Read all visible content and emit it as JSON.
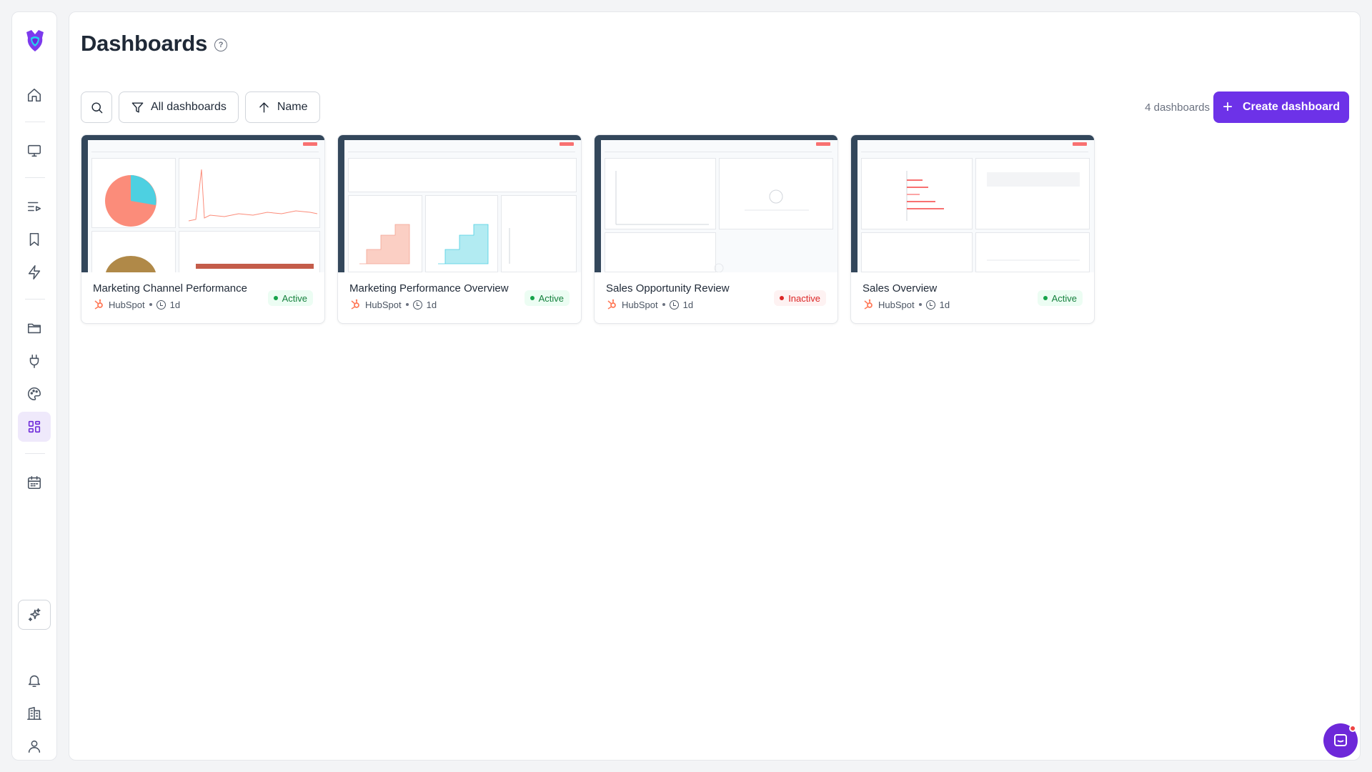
{
  "page": {
    "title": "Dashboards",
    "count_label": "4 dashboards",
    "create_label": "Create dashboard"
  },
  "toolbar": {
    "filter_label": "All dashboards",
    "sort_label": "Name"
  },
  "sidebar": {
    "items": [
      {
        "name": "home-icon"
      },
      {
        "name": "monitor-icon"
      },
      {
        "name": "playlist-icon"
      },
      {
        "name": "bookmark-icon"
      },
      {
        "name": "lightning-icon"
      },
      {
        "name": "folder-icon"
      },
      {
        "name": "plug-icon"
      },
      {
        "name": "palette-icon"
      },
      {
        "name": "dashboard-grid-icon",
        "active": true
      },
      {
        "name": "calendar-icon"
      },
      {
        "name": "sparkle-ai-icon"
      },
      {
        "name": "bell-icon"
      },
      {
        "name": "building-icon"
      },
      {
        "name": "user-icon"
      }
    ]
  },
  "colors": {
    "accent": "#6d32e8",
    "active_badge": "#15803d",
    "inactive_badge": "#dc2626",
    "hubspot": "#ff7a59"
  },
  "cards": [
    {
      "title": "Marketing Channel Performance",
      "source": "HubSpot",
      "age": "1d",
      "status": "Active"
    },
    {
      "title": "Marketing Performance Overview",
      "source": "HubSpot",
      "age": "1d",
      "status": "Active"
    },
    {
      "title": "Sales Opportunity Review",
      "source": "HubSpot",
      "age": "1d",
      "status": "Inactive"
    },
    {
      "title": "Sales Overview",
      "source": "HubSpot",
      "age": "1d",
      "status": "Active"
    }
  ]
}
